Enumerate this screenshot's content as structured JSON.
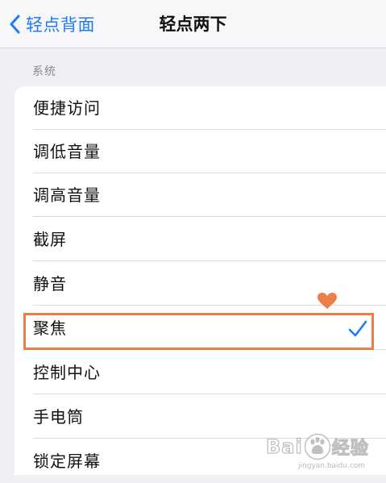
{
  "nav": {
    "back_label": "轻点背面",
    "title": "轻点两下"
  },
  "section": {
    "header": "系统"
  },
  "options": [
    {
      "label": "便捷访问"
    },
    {
      "label": "调低音量"
    },
    {
      "label": "调高音量"
    },
    {
      "label": "截屏"
    },
    {
      "label": "静音"
    },
    {
      "label": "聚焦",
      "selected": true
    },
    {
      "label": "控制中心"
    },
    {
      "label": "手电筒"
    },
    {
      "label": "锁定屏幕"
    }
  ],
  "watermark": {
    "brand_left": "Bai",
    "brand_right": "经验",
    "url": "jingyan.baidu.com"
  },
  "colors": {
    "accent": "#1f7cf2",
    "annotation": "#ec7e48",
    "background": "#efeff4",
    "cell": "#ffffff"
  },
  "icons": {
    "back": "chevron-left-icon",
    "selected": "checkmark-icon",
    "annotation": "heart-icon"
  }
}
